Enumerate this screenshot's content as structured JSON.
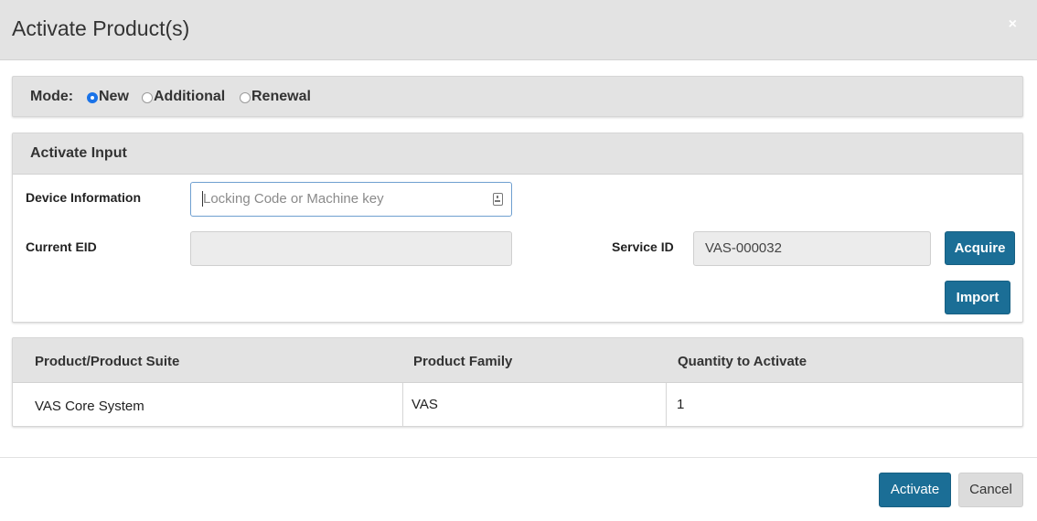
{
  "dialog": {
    "title": "Activate Product(s)",
    "close_symbol": "×"
  },
  "mode": {
    "label": "Mode:",
    "options": [
      {
        "label": "New",
        "selected": true
      },
      {
        "label": "Additional",
        "selected": false
      },
      {
        "label": "Renewal",
        "selected": false
      }
    ]
  },
  "activate_input": {
    "title": "Activate Input",
    "device_information": {
      "label": "Device Information",
      "value": "",
      "placeholder": "Locking Code or Machine key",
      "icon": "key-icon"
    },
    "current_eid": {
      "label": "Current EID",
      "value": ""
    },
    "service_id": {
      "label": "Service ID",
      "value": "VAS-000032"
    },
    "acquire_label": "Acquire",
    "import_label": "Import"
  },
  "products_table": {
    "columns": [
      "Product/Product Suite",
      "Product Family",
      "Quantity to Activate"
    ],
    "rows": [
      [
        "VAS Core System",
        "VAS",
        "1"
      ]
    ]
  },
  "footer": {
    "activate_label": "Activate",
    "cancel_label": "Cancel"
  },
  "colors": {
    "primary_button": "#1b6e96",
    "header_bg": "#e3e3e3",
    "radio_selected": "#1a73e8"
  }
}
